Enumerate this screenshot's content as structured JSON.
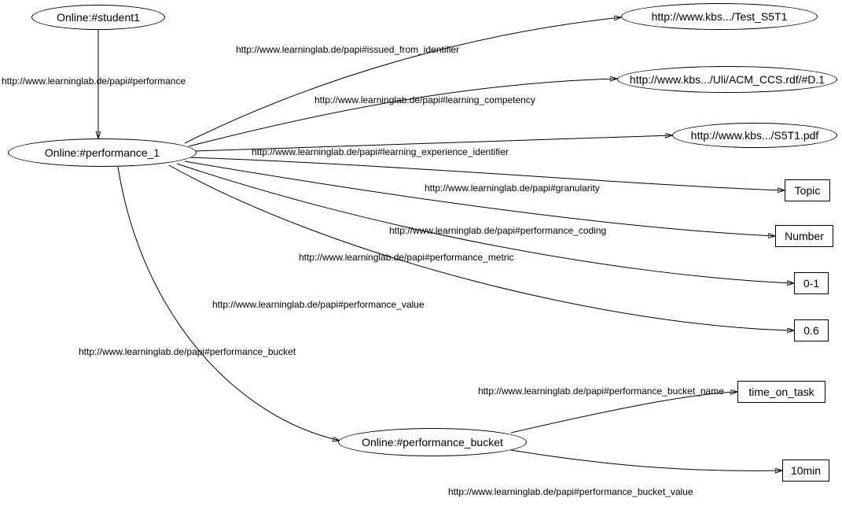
{
  "nodes": {
    "student1": "Online:#student1",
    "performance1": "Online:#performance_1",
    "performance_bucket": "Online:#performance_bucket",
    "test_s5t1": "http://www.kbs.../Test_S5T1",
    "acm_ccs": "http://www.kbs.../Uli/ACM_CCS.rdf/#D.1",
    "s5t1_pdf": "http://www.kbs.../S5T1.pdf",
    "topic": "Topic",
    "number": "Number",
    "zero_one": "0-1",
    "zero_six": "0.6",
    "time_on_task": "time_on_task",
    "ten_min": "10min"
  },
  "edges": {
    "performance": "http://www.learninglab.de/papi#performance",
    "issued_from_identifier": "http://www.learninglab.de/papi#issued_from_identifier",
    "learning_competency": "http://www.learninglab.de/papi#learning_competency",
    "learning_experience_identifier": "http://www.learninglab.de/papi#learning_experience_identifier",
    "granularity": "http://www.learninglab.de/papi#granularity",
    "performance_coding": "http://www.learninglab.de/papi#performance_coding",
    "performance_metric": "http://www.learninglab.de/papi#performance_metric",
    "performance_value": "http://www.learninglab.de/papi#performance_value",
    "performance_bucket": "http://www.learninglab.de/papi#performance_bucket",
    "performance_bucket_name": "http://www.learninglab.de/papi#performance_bucket_name",
    "performance_bucket_value": "http://www.learninglab.de/papi#performance_bucket_value"
  },
  "chart_data": {
    "type": "graph",
    "description": "RDF-style directed graph. Ellipses are resources, rectangles are literals.",
    "nodes": [
      {
        "id": "student1",
        "label": "Online:#student1",
        "shape": "ellipse"
      },
      {
        "id": "performance1",
        "label": "Online:#performance_1",
        "shape": "ellipse"
      },
      {
        "id": "performance_bucket",
        "label": "Online:#performance_bucket",
        "shape": "ellipse"
      },
      {
        "id": "test_s5t1",
        "label": "http://www.kbs.../Test_S5T1",
        "shape": "ellipse"
      },
      {
        "id": "acm_ccs",
        "label": "http://www.kbs.../Uli/ACM_CCS.rdf/#D.1",
        "shape": "ellipse"
      },
      {
        "id": "s5t1_pdf",
        "label": "http://www.kbs.../S5T1.pdf",
        "shape": "ellipse"
      },
      {
        "id": "topic",
        "label": "Topic",
        "shape": "rect"
      },
      {
        "id": "number",
        "label": "Number",
        "shape": "rect"
      },
      {
        "id": "zero_one",
        "label": "0-1",
        "shape": "rect"
      },
      {
        "id": "zero_six",
        "label": "0.6",
        "shape": "rect"
      },
      {
        "id": "time_on_task",
        "label": "time_on_task",
        "shape": "rect"
      },
      {
        "id": "ten_min",
        "label": "10min",
        "shape": "rect"
      }
    ],
    "edges": [
      {
        "from": "student1",
        "to": "performance1",
        "label": "http://www.learninglab.de/papi#performance"
      },
      {
        "from": "performance1",
        "to": "test_s5t1",
        "label": "http://www.learninglab.de/papi#issued_from_identifier"
      },
      {
        "from": "performance1",
        "to": "acm_ccs",
        "label": "http://www.learninglab.de/papi#learning_competency"
      },
      {
        "from": "performance1",
        "to": "s5t1_pdf",
        "label": "http://www.learninglab.de/papi#learning_experience_identifier"
      },
      {
        "from": "performance1",
        "to": "topic",
        "label": "http://www.learninglab.de/papi#granularity"
      },
      {
        "from": "performance1",
        "to": "number",
        "label": "http://www.learninglab.de/papi#performance_coding"
      },
      {
        "from": "performance1",
        "to": "zero_one",
        "label": "http://www.learninglab.de/papi#performance_metric"
      },
      {
        "from": "performance1",
        "to": "zero_six",
        "label": "http://www.learninglab.de/papi#performance_value"
      },
      {
        "from": "performance1",
        "to": "performance_bucket",
        "label": "http://www.learninglab.de/papi#performance_bucket"
      },
      {
        "from": "performance_bucket",
        "to": "time_on_task",
        "label": "http://www.learninglab.de/papi#performance_bucket_name"
      },
      {
        "from": "performance_bucket",
        "to": "ten_min",
        "label": "http://www.learninglab.de/papi#performance_bucket_value"
      }
    ]
  }
}
